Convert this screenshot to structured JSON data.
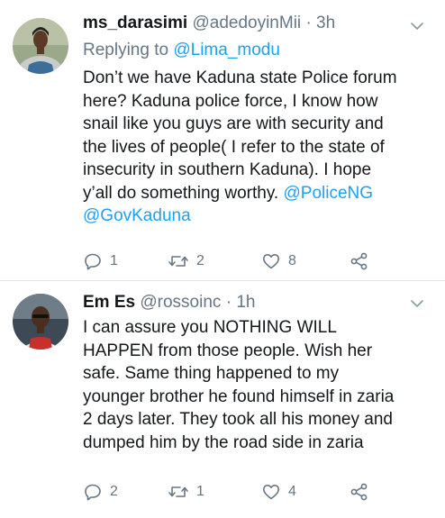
{
  "tweets": [
    {
      "name": "ms_darasimi",
      "handle": "@adedoyinMii",
      "separator": "·",
      "time": "3h",
      "reply_prefix": "Replying to",
      "reply_to": "@Lima_modu",
      "body_lines": [
        "Don’t we have Kaduna state Police forum",
        "here? Kaduna police force, I know how",
        "snail like you guys are with security and",
        "the lives of people( I refer to the state of",
        "insecurity in southern Kaduna). I hope",
        "y’all do something worthy. ",
        "@GovKaduna"
      ],
      "mention_inline": "@PoliceNG",
      "replies": "1",
      "retweets": "2",
      "likes": "8",
      "avatar_icon": "woman-avatar-icon"
    },
    {
      "name": "Em Es",
      "handle": "@rossoinc",
      "separator": "·",
      "time": "1h",
      "body_lines": [
        "I can assure you NOTHING WILL",
        "HAPPEN from those people. Wish her",
        "safe. Same thing happened to my",
        "younger brother he found himself in zaria",
        "2 days later. They took all his money and",
        "dumped him by the road side in zaria"
      ],
      "replies": "2",
      "retweets": "1",
      "likes": "4",
      "avatar_icon": "man-avatar-icon"
    }
  ],
  "colors": {
    "text": "#14171a",
    "secondary": "#657786",
    "link": "#1da1f2",
    "divider": "#e1e8ed"
  }
}
